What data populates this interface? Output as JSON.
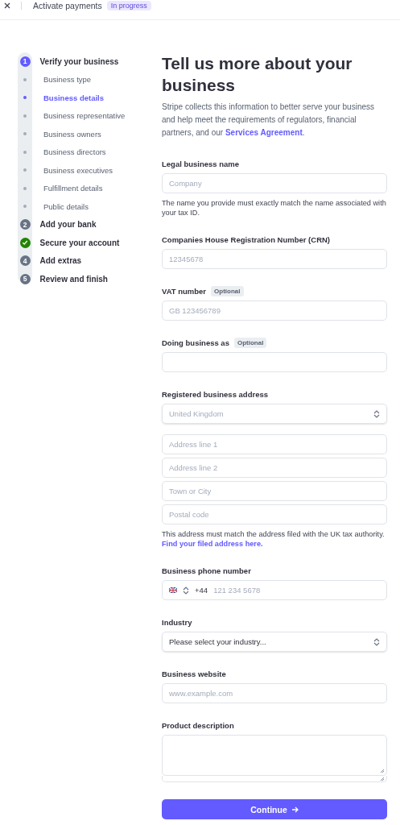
{
  "header": {
    "title": "Activate payments",
    "badge": "In progress"
  },
  "steps": [
    {
      "number": "1",
      "label": "Verify your business",
      "current": true,
      "done": false,
      "children": [
        {
          "label": "Business type",
          "selected": false
        },
        {
          "label": "Business details",
          "selected": true
        },
        {
          "label": "Business representative",
          "selected": false
        },
        {
          "label": "Business owners",
          "selected": false
        },
        {
          "label": "Business directors",
          "selected": false
        },
        {
          "label": "Business executives",
          "selected": false
        },
        {
          "label": "Fulfillment details",
          "selected": false
        },
        {
          "label": "Public details",
          "selected": false
        }
      ]
    },
    {
      "number": "2",
      "label": "Add your bank",
      "current": false,
      "done": false
    },
    {
      "label": "Secure your account",
      "current": false,
      "done": true
    },
    {
      "number": "4",
      "label": "Add extras",
      "current": false,
      "done": false
    },
    {
      "number": "5",
      "label": "Review and finish",
      "current": false,
      "done": false
    }
  ],
  "form": {
    "title": "Tell us more about your business",
    "intro": "Stripe collects this information to better serve your business and help meet the requirements of regulators, financial partners, and our ",
    "intro_link": "Services Agreement",
    "intro_end": ".",
    "fields": [
      {
        "kind": "text",
        "label": "Legal business name",
        "placeholder": "Company",
        "help": "The name you provide must exactly match the name associated with your tax ID."
      },
      {
        "kind": "text",
        "label": "Companies House Registration Number (CRN)",
        "placeholder": "12345678"
      },
      {
        "kind": "text",
        "label": "VAT number",
        "badge": "Optional",
        "placeholder": "GB 123456789"
      },
      {
        "kind": "text",
        "label": "Doing business as",
        "badge": "Optional"
      },
      {
        "kind": "address",
        "label": "Registered business address",
        "country": "United Kingdom",
        "lines": [
          {
            "placeholder": "Address line 1"
          },
          {
            "placeholder": "Address line 2"
          },
          {
            "placeholder": "Town or City"
          },
          {
            "placeholder": "Postal code"
          }
        ],
        "help": "This address must match the address filed with the UK tax authority.",
        "help_link": "Find your filed address here."
      },
      {
        "kind": "phone",
        "label": "Business phone number",
        "code": "+44",
        "placeholder": "121 234 5678"
      },
      {
        "kind": "select",
        "label": "Industry",
        "value": "Please select your industry..."
      },
      {
        "kind": "text",
        "label": "Business website",
        "placeholder": "www.example.com"
      },
      {
        "kind": "textarea",
        "label": "Product description"
      }
    ],
    "submit": "Continue"
  }
}
